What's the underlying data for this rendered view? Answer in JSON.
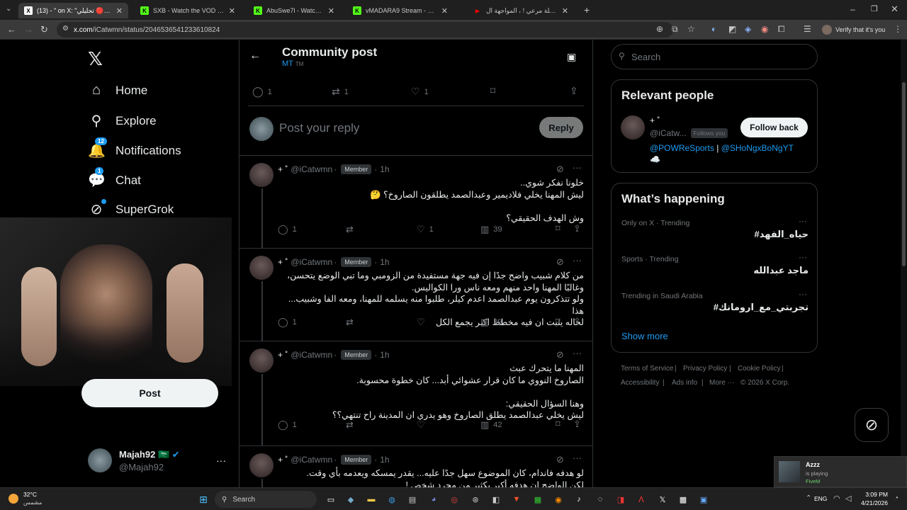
{
  "browser": {
    "tabs": [
      {
        "title": "(13) - \" on X: \"تحليلي 🔴 \" / X",
        "active": true,
        "fav": "X",
        "favcolor": "#ffffff"
      },
      {
        "title": "SXB - Watch the VOD on Kick",
        "active": false,
        "fav": "K",
        "favcolor": "#53fc18"
      },
      {
        "title": "AbuSwe7l - Watch the VOD on",
        "active": false,
        "fav": "K",
        "favcolor": "#53fc18"
      },
      {
        "title": "vMADARA9 Stream - Watch Live",
        "active": false,
        "fav": "K",
        "favcolor": "#53fc18"
      },
      {
        "title": "نهاية سلسلة مرعي ! ، المواجهة ال",
        "active": false,
        "fav": "▶",
        "favcolor": "#ff0000"
      }
    ],
    "url_domain": "x.com",
    "url_path": "/iCatwmn/status/2046536541233610824",
    "verify_label": "Verify that it's you"
  },
  "sidebar": {
    "items": [
      {
        "label": "Home",
        "icon": "home-icon",
        "glyph": "⌂"
      },
      {
        "label": "Explore",
        "icon": "search-icon",
        "glyph": "⚲"
      },
      {
        "label": "Notifications",
        "icon": "bell-icon",
        "glyph": "🔔",
        "badge": "12"
      },
      {
        "label": "Chat",
        "icon": "chat-icon",
        "glyph": "💬",
        "badge": "1"
      },
      {
        "label": "SuperGrok",
        "icon": "grok-icon",
        "glyph": "⊘"
      }
    ],
    "post_label": "Post",
    "account": {
      "name": "Majah92",
      "flag": "🇸🇦",
      "handle": "@Majah92"
    }
  },
  "header": {
    "title": "Community post",
    "subtitle": "MT",
    "tm": "TM"
  },
  "main_post_actions": {
    "replies": "1",
    "reposts": "1",
    "likes": "1"
  },
  "reply_box": {
    "placeholder": "Post your reply",
    "button": "Reply"
  },
  "posts": [
    {
      "name": "+ ˚",
      "handle": "@iCatwmn",
      "badge": "Member",
      "time": "1h",
      "body": "خلونا نفكر شوي..\nليش المهنا يخلي فلاديمير وعبدالصمد يطلقون الصاروخ؟ 🤔\n\nوش الهدف الحقيقي؟",
      "replies": "1",
      "reposts": "",
      "likes": "1",
      "views": "39"
    },
    {
      "name": "+ ˚",
      "handle": "@iCatwmn",
      "badge": "Member",
      "time": "1h",
      "body": "من كلام شبيب واضح جدًا إن فيه جهة مستفيدة من الزومبي وما تبي الوضع يتحسن،\nوغالبًا المهنا واحد منهم ومعه ناس ورا الكواليس.\nولو تتذكرون يوم عبدالصمد اعدم كيلر، طلبوا منه يسلمه للمهنا، ومعه الفا وشبيب... هذا\nلحاله يثبت ان فيه مخطط اكبر يجمع الكل",
      "replies": "1",
      "reposts": "",
      "likes": "",
      "views": "39"
    },
    {
      "name": "+ ˚",
      "handle": "@iCatwmn",
      "badge": "Member",
      "time": "1h",
      "body": "المهنا ما يتحرك عبث\nالصاروخ النووي ما كان قرار عشوائي أبد... كان خطوة محسوبة.\n\nوهنا السؤال الحقيقي:\nليش يخلي عبدالصمد يطلق الصاروخ وهو يدري ان المدينة راح تنتهي؟؟",
      "replies": "1",
      "reposts": "",
      "likes": "",
      "views": "42"
    },
    {
      "name": "+ ˚",
      "handle": "@iCatwmn",
      "badge": "Member",
      "time": "1h",
      "body": "لو هدفه فاندام، كان الموضوع سهل جدًا عليه... يقدر يمسكه ويعدمه بأي وقت.\nلكن الواضح إن هدفه أكبر بكثير من مجرد شخص !",
      "replies": "",
      "reposts": "",
      "likes": "",
      "views": ""
    }
  ],
  "right": {
    "search_placeholder": "Search",
    "relevant": {
      "title": "Relevant people",
      "name": "+ ˚",
      "handle": "@iCatw...",
      "follows_you": "Follows you",
      "button": "Follow back",
      "bio_link1": "@POWReSports",
      "bio_sep": "|",
      "bio_link2": "@SHoNgxBoNgYT",
      "bio_emoji": "☁️"
    },
    "happening": {
      "title": "What’s happening",
      "trends": [
        {
          "context": "Only on X · Trending",
          "name": "#حياه_الفهد"
        },
        {
          "context": "Sports · Trending",
          "name": "ماجد عبدالله"
        },
        {
          "context": "Trending in Saudi Arabia",
          "name": "#تجربتي_مع_ارومانك"
        }
      ],
      "show_more": "Show more"
    },
    "footer": [
      "Terms of Service",
      "|",
      "Privacy Policy",
      "|",
      "Cookie Policy",
      "|",
      "Accessibility",
      "|",
      "Ads info",
      "|",
      "More ···",
      "© 2026 X Corp."
    ]
  },
  "toast": {
    "title": "Azzz",
    "line1": "is playing",
    "line2": "FiveM"
  },
  "taskbar": {
    "weather_temp": "32°C",
    "weather_desc": "مشمس",
    "search_label": "Search",
    "lang": "ENG",
    "time": "3:09 PM",
    "date": "4/21/2026"
  }
}
